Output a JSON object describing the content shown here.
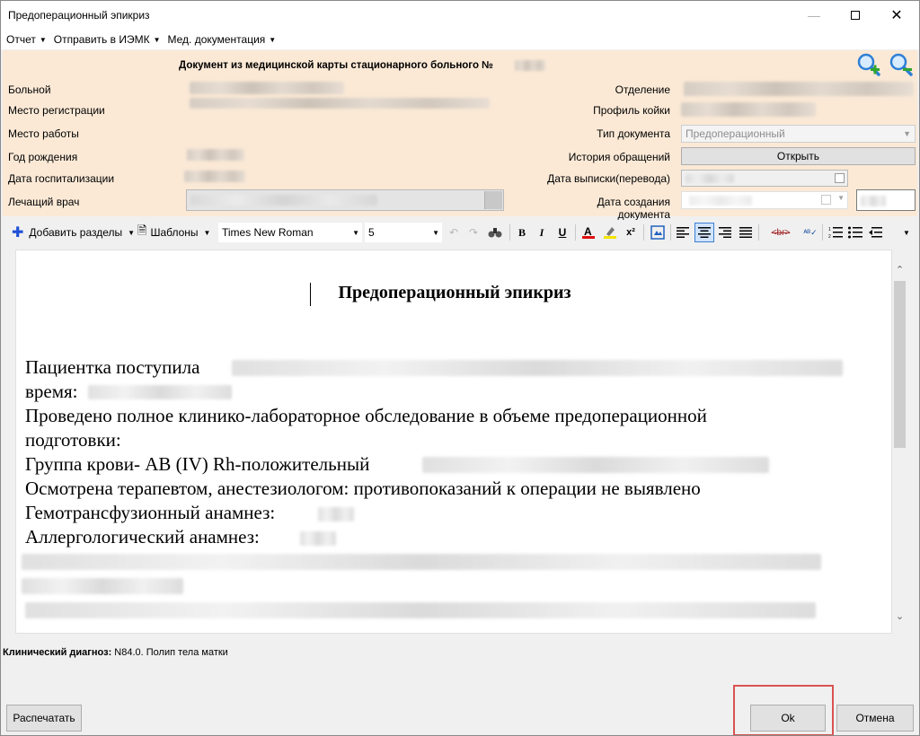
{
  "window": {
    "title": "Предоперационный эпикриз"
  },
  "menu": [
    {
      "label": "Отчет"
    },
    {
      "label": "Отправить в ИЭМК"
    },
    {
      "label": "Мед. документация"
    }
  ],
  "header": {
    "doc_title": "Документ из медицинской карты стационарного больного №",
    "labels_left": {
      "patient": "Больной",
      "registration": "Место регистрации",
      "work": "Место работы",
      "birth_year": "Год рождения",
      "hosp_date": "Дата госпитализации",
      "doctor": "Лечащий врач"
    },
    "labels_right": {
      "department": "Отделение",
      "bed_profile": "Профиль койки",
      "doc_type": "Тип документа",
      "history": "История обращений",
      "discharge_date": "Дата выписки(перевода)",
      "created_date": "Дата создания документа"
    },
    "doc_type_value": "Предоперационный",
    "open_button": "Открыть"
  },
  "toolbar": {
    "add_sections": "Добавить разделы",
    "templates": "Шаблоны",
    "font_family": "Times New Roman",
    "font_size": "5",
    "bold": "B",
    "italic": "I",
    "underline": "U",
    "superscript": "x²",
    "br_tag": "<br>"
  },
  "editor": {
    "heading": "Предоперационный эпикриз",
    "lines": [
      "Пациентка поступила",
      "время:",
      "Проведено полное клинико-лабораторное обследование в объеме предоперационной",
      "подготовки:",
      "Группа крови- AB (IV) Rh-положительный",
      "Осмотрена терапевтом, анестезиологом: противопоказаний к операции не выявлено",
      "Гемотрансфузионный анамнез:",
      "Аллергологический анамнез:"
    ]
  },
  "diagnosis": {
    "label": "Клинический диагноз:",
    "value": "N84.0. Полип тела матки"
  },
  "buttons": {
    "print": "Распечатать",
    "ok": "Ok",
    "cancel": "Отмена"
  }
}
